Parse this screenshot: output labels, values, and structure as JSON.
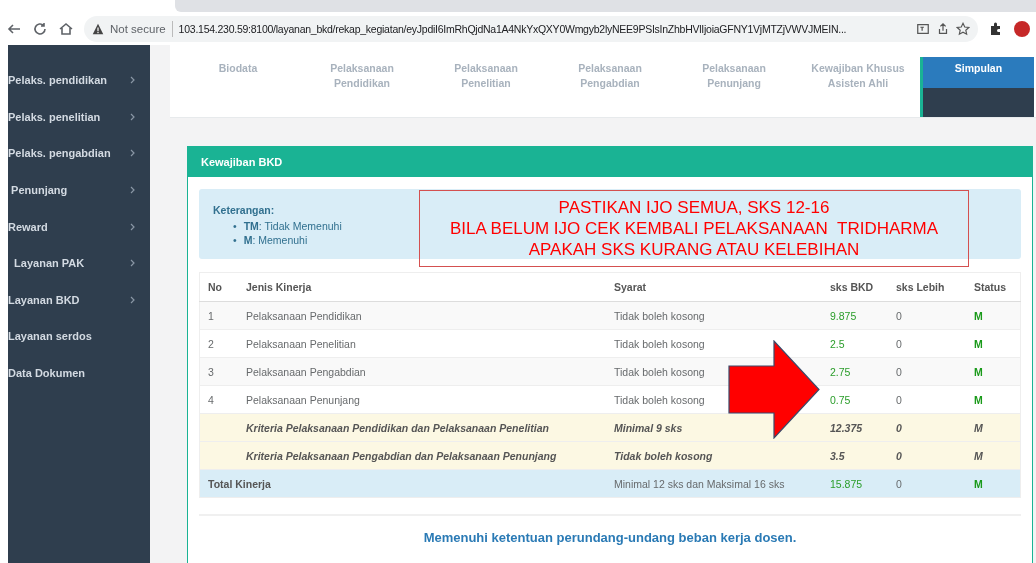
{
  "browser": {
    "security": "Not secure",
    "url": "103.154.230.59:8100/layanan_bkd/rekap_kegiatan/eyJpdiI6ImRhQjdNa1A4NkYxQXY0Wmgyb2lyNEE9PSIsInZhbHVlIjoiaGFNY1VjMTZjVWVJMEIN..."
  },
  "sidebar": {
    "items": [
      {
        "label": "Pelaks. pendidikan",
        "has_submenu": true
      },
      {
        "label": "Pelaks. penelitian",
        "has_submenu": true
      },
      {
        "label": "Pelaks. pengabdian",
        "has_submenu": true
      },
      {
        "label": " Penunjang",
        "has_submenu": true
      },
      {
        "label": "Reward",
        "has_submenu": true
      },
      {
        "label": "  Layanan PAK",
        "has_submenu": true
      },
      {
        "label": "Layanan BKD",
        "has_submenu": true
      },
      {
        "label": "Layanan serdos",
        "has_submenu": false
      },
      {
        "label": "Data Dokumen",
        "has_submenu": false
      }
    ]
  },
  "tabs": [
    {
      "label": "Biodata",
      "selected": false
    },
    {
      "label": "Pelaksanaan Pendidikan",
      "selected": false
    },
    {
      "label": "Pelaksanaan Penelitian",
      "selected": false
    },
    {
      "label": "Pelaksanaan Pengabdian",
      "selected": false
    },
    {
      "label": "Pelaksanaan Penunjang",
      "selected": false
    },
    {
      "label": "Kewajiban Khusus Asisten Ahli",
      "selected": false
    },
    {
      "label": "Simpulan",
      "selected": true
    }
  ],
  "card": {
    "title": "Kewajiban BKD",
    "legend": {
      "title": "Keterangan:",
      "items": [
        {
          "marker": "•",
          "text": "**TM**: Tidak Memenuhi"
        },
        {
          "marker": "•",
          "text": "**M**: Memenuhi"
        }
      ]
    },
    "annotation": {
      "lines": [
        "PASTIKAN IJO SEMUA, SKS 12-16",
        "BILA BELUM IJO CEK KEMBALI PELAKSANAAN  TRIDHARMA",
        "APAKAH SKS KURANG ATAU KELEBIHAN"
      ]
    },
    "table": {
      "columns": [
        "No",
        "Jenis Kinerja",
        "Syarat",
        "sks BKD",
        "sks Lebih",
        "Status"
      ],
      "rows": [
        {
          "kind": "item",
          "no": "1",
          "name": "Pelaksanaan Pendidikan",
          "requirement": "Tidak boleh kosong",
          "sks_bkd": "9.875",
          "sks_lebih": "0",
          "status": "M"
        },
        {
          "kind": "item",
          "no": "2",
          "name": "Pelaksanaan Penelitian",
          "requirement": "Tidak boleh kosong",
          "sks_bkd": "2.5",
          "sks_lebih": "0",
          "status": "M"
        },
        {
          "kind": "item",
          "no": "3",
          "name": "Pelaksanaan Pengabdian",
          "requirement": "Tidak boleh kosong",
          "sks_bkd": "2.75",
          "sks_lebih": "0",
          "status": "M"
        },
        {
          "kind": "item",
          "no": "4",
          "name": "Pelaksanaan Penunjang",
          "requirement": "Tidak boleh kosong",
          "sks_bkd": "0.75",
          "sks_lebih": "0",
          "status": "M"
        },
        {
          "kind": "criteria",
          "name": "Kriteria Pelaksanaan Pendidikan dan Pelaksanaan Penelitian",
          "requirement": "Minimal 9 sks",
          "sks_bkd": "12.375",
          "sks_lebih": "0",
          "status": "M"
        },
        {
          "kind": "criteria",
          "name": "Kriteria Pelaksanaan Pengabdian dan Pelaksanaan Penunjang",
          "requirement": "Tidak boleh kosong",
          "sks_bkd": "3.5",
          "sks_lebih": "0",
          "status": "M"
        },
        {
          "kind": "total",
          "name": "Total Kinerja",
          "requirement": "Minimal 12 sks dan Maksimal 16 sks",
          "sks_bkd": "15.875",
          "sks_lebih": "0",
          "status": "M"
        }
      ]
    },
    "message": "Memenuhi ketentuan perundang-undang beban kerja dosen."
  }
}
